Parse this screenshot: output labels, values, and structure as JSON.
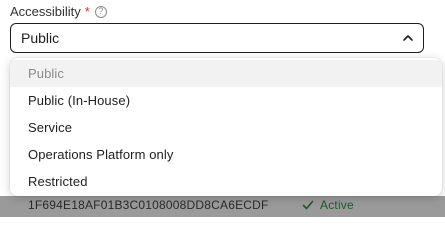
{
  "field": {
    "label": "Accessibility",
    "required_marker": "*",
    "help_glyph": "?",
    "value": "Public"
  },
  "dropdown": {
    "options": [
      {
        "label": "Public",
        "selected": true
      },
      {
        "label": "Public (In-House)",
        "selected": false
      },
      {
        "label": "Service",
        "selected": false
      },
      {
        "label": "Operations Platform only",
        "selected": false
      },
      {
        "label": "Restricted",
        "selected": false
      }
    ]
  },
  "background_row": {
    "id_text": "1F694E18AF01B3C0108008DD8CA6ECDF",
    "status_text": "Active",
    "status_icon": "check-icon"
  },
  "colors": {
    "border": "#1e1e1e",
    "required": "#d93025",
    "selected_option_bg": "#f2f2f2",
    "selected_option_text": "#8a8a8a",
    "status_active": "#1d5a2c"
  }
}
